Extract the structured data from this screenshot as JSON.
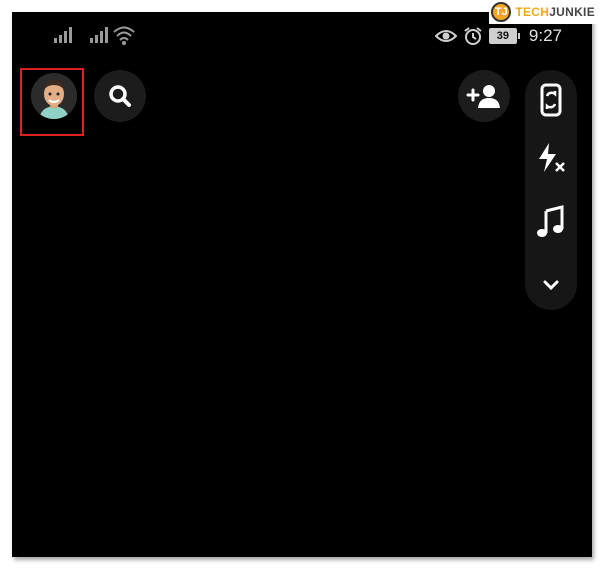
{
  "watermark": {
    "tech": "TECH",
    "junkie": "JUNKIE",
    "mark": "TJ"
  },
  "status_bar": {
    "battery_level": "39",
    "time": "9:27"
  },
  "colors": {
    "highlight_border": "#e02020",
    "background": "#000000",
    "button_bg": "#1c1c1c",
    "accent_logo": "#f5a623"
  },
  "icons": {
    "profile": "bitmoji-avatar",
    "search": "search-icon",
    "add_friend": "add-friend-icon",
    "flip_camera": "flip-camera-icon",
    "flash": "flash-off-icon",
    "music": "music-icon",
    "more": "chevron-down-icon"
  }
}
